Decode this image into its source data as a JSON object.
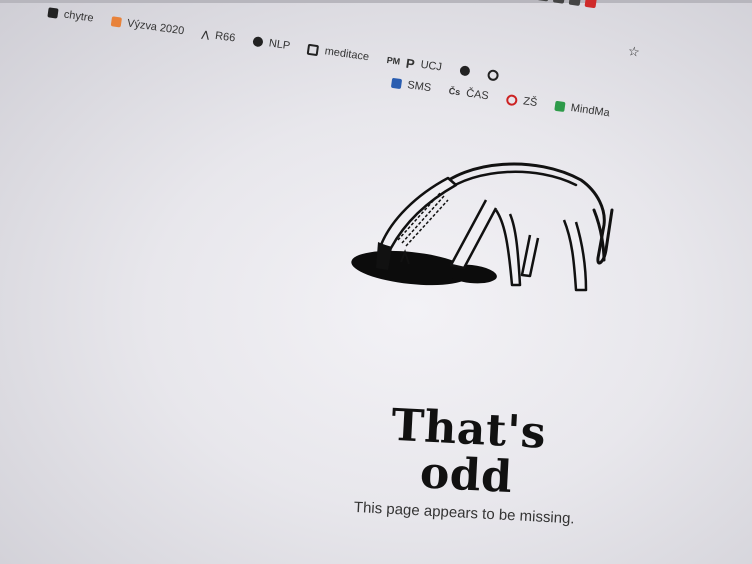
{
  "bookmarks_row1": [
    {
      "label": "chytre",
      "icon": "bookmark-icon"
    },
    {
      "label": "Výzva 2020",
      "icon": "orange-page-icon"
    },
    {
      "label": "R66",
      "icon": "aiyu-logo-icon"
    },
    {
      "label": "NLP",
      "icon": "hexagon-icon"
    },
    {
      "label": "meditace",
      "icon": "frame-icon"
    },
    {
      "label": "UCJ",
      "icon": "p-letter-icon"
    }
  ],
  "bookmarks_row2": [
    {
      "label": "SMS",
      "icon": "chat-icon"
    },
    {
      "label": "ČAS",
      "icon": "cas-logo-icon"
    },
    {
      "label": "ZŠ",
      "icon": "hexagon-icon"
    },
    {
      "label": "MindMa",
      "icon": "mindmap-icon"
    }
  ],
  "error": {
    "headline": "That's odd",
    "message": "This page appears to be missing."
  },
  "colors": {
    "page_background": "#ece9ef",
    "text_primary": "#111111",
    "accent_orange": "#e8823a"
  }
}
